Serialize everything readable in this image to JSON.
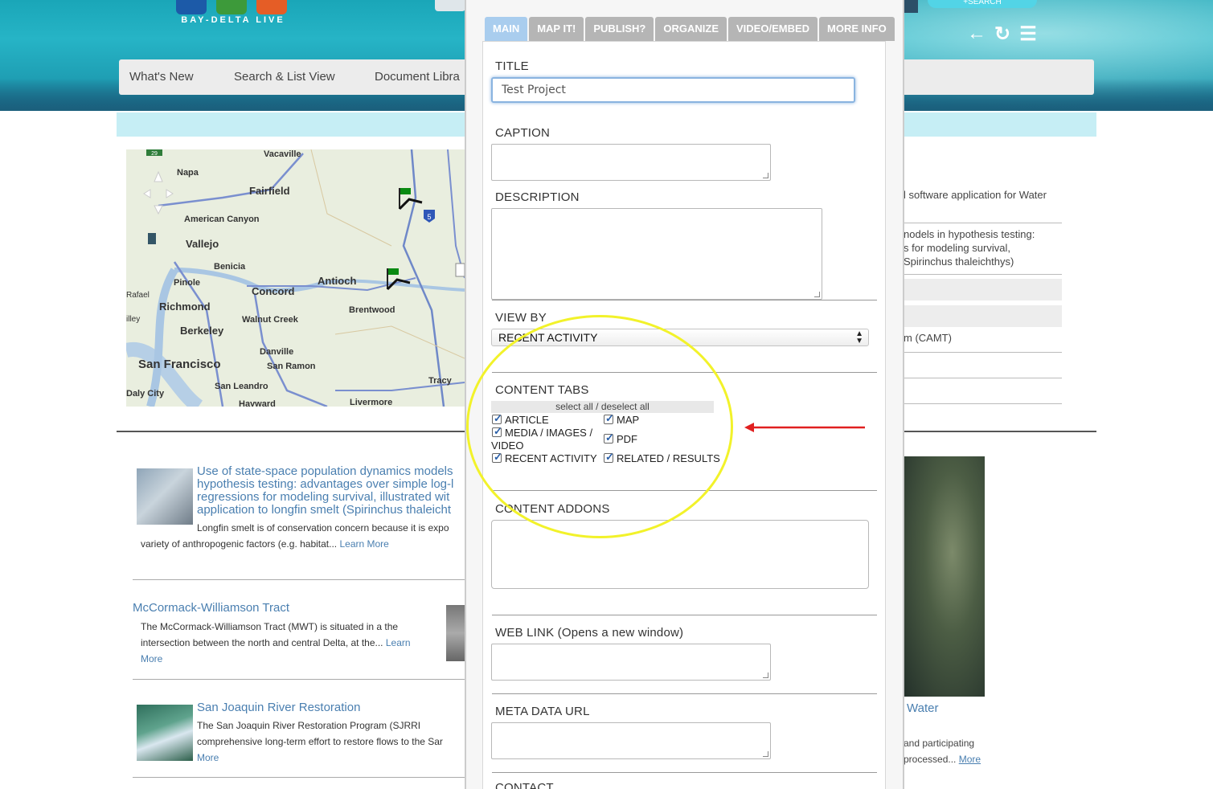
{
  "header": {
    "logo_text": "BAY-DELTA LIVE",
    "search_label": "+SEARCH",
    "icons": [
      "arrow-left-icon",
      "refresh-icon",
      "list-icon"
    ]
  },
  "nav": {
    "items": [
      "What's New",
      "Search & List View",
      "Document Libra"
    ]
  },
  "map": {
    "cities": [
      "Vacaville",
      "Napa",
      "Fairfield",
      "American Canyon",
      "Vallejo",
      "Benicia",
      "Pinole",
      "Concord",
      "Antioch",
      "Richmond",
      "Walnut Creek",
      "Brentwood",
      "Berkeley",
      "Danville",
      "San Francisco",
      "San Ramon",
      "San Leandro",
      "Tracy",
      "Daly City",
      "Hayward",
      "Livermore",
      "Rafael",
      "illey"
    ],
    "shields": [
      "5",
      "29"
    ]
  },
  "right_panel": {
    "lines": [
      "l software application for Water",
      "nodels in hypothesis testing:",
      "s for modeling survival,",
      "Spirinchus thaleichthys)",
      "m (CAMT)"
    ]
  },
  "articles": [
    {
      "title_lines": [
        "Use of state-space population dynamics models",
        "hypothesis testing: advantages over simple log-l",
        "regressions for modeling survival, illustrated wit",
        "application to longfin smelt (Spirinchus thaleicht"
      ],
      "body_lines": [
        "Longfin smelt is of conservation concern because it is expo",
        "variety of anthropogenic factors (e.g. habitat..."
      ],
      "more": "Learn More"
    },
    {
      "title": "McCormack-Williamson Tract",
      "body_lines": [
        "The McCormack-Williamson Tract (MWT) is situated in a the",
        "intersection between the north and central Delta, at the..."
      ],
      "more_1": "Learn",
      "more_2": "More"
    },
    {
      "title": "San Joaquin River Restoration",
      "body_lines": [
        "The San Joaquin River Restoration Program (SJRRI",
        "comprehensive long-term effort to restore flows to the Sar"
      ],
      "more": "More"
    }
  ],
  "water_card": {
    "title": "Water",
    "body_lines": [
      "and participating",
      "processed..."
    ],
    "more": "More"
  },
  "modal": {
    "tabs": [
      "MAIN",
      "MAP IT!",
      "PUBLISH?",
      "ORGANIZE",
      "VIDEO/EMBED",
      "MORE INFO"
    ],
    "active_tab": "MAIN",
    "fields": {
      "title_label": "TITLE",
      "title_value": "Test Project",
      "caption_label": "CAPTION",
      "description_label": "DESCRIPTION",
      "view_by_label": "VIEW BY",
      "view_by_value": "RECENT ACTIVITY",
      "content_tabs_label": "CONTENT TABS",
      "select_all": "select all / deselect all",
      "checkboxes": [
        "ARTICLE",
        "MAP",
        "MEDIA / IMAGES /",
        "VIDEO",
        "PDF",
        "RECENT ACTIVITY",
        "RELATED / RESULTS"
      ],
      "content_addons_label": "CONTENT ADDONS",
      "web_link_label": "WEB LINK (Opens a new window)",
      "meta_data_label": "META DATA URL",
      "contact_label": "CONTACT"
    }
  },
  "annotations": {
    "highlight_color": "#f2f22a",
    "arrow_color": "#e02020"
  }
}
